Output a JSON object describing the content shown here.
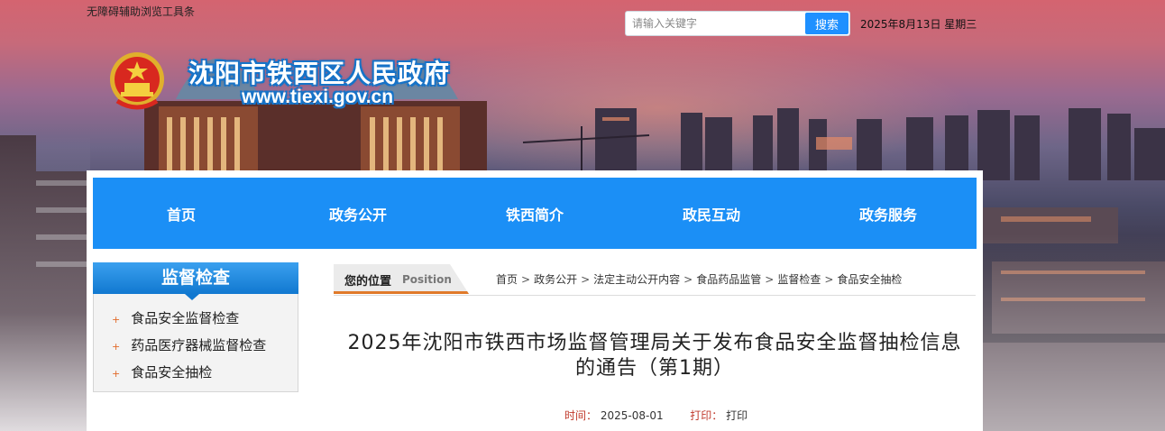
{
  "top": {
    "accessibility_label": "无障碍辅助浏览工具条",
    "search_placeholder": "请输入关键字",
    "search_button": "搜索",
    "date": "2025年8月13日 星期三"
  },
  "site": {
    "title": "沈阳市铁西区人民政府",
    "url": "www.tiexi.gov.cn"
  },
  "nav": {
    "items": [
      {
        "label": "首页"
      },
      {
        "label": "政务公开"
      },
      {
        "label": "铁西简介"
      },
      {
        "label": "政民互动"
      },
      {
        "label": "政务服务"
      }
    ]
  },
  "sidebar": {
    "title": "监督检查",
    "items": [
      {
        "label": "食品安全监督检查"
      },
      {
        "label": "药品医疗器械监督检查"
      },
      {
        "label": "食品安全抽检"
      }
    ]
  },
  "location": {
    "label": "您的位置",
    "label_en": "Position",
    "crumbs": [
      {
        "label": "首页"
      },
      {
        "label": "政务公开"
      },
      {
        "label": "法定主动公开内容"
      },
      {
        "label": "食品药品监管"
      },
      {
        "label": "监督检查"
      },
      {
        "label": "食品安全抽检"
      }
    ]
  },
  "article": {
    "title": "2025年沈阳市铁西市场监督管理局关于发布食品安全监督抽检信息的通告（第1期）",
    "time_label": "时间：",
    "time_value": "2025-08-01",
    "print_label": "打印：",
    "print_value": "打印"
  },
  "colors": {
    "nav_blue": "#1b8ff6",
    "sidebar_blue": "#1178d0",
    "accent_orange": "#e07a2a",
    "meta_red": "#c0392b"
  },
  "icons": [
    "national-emblem-icon",
    "plus-bullet-icon"
  ]
}
